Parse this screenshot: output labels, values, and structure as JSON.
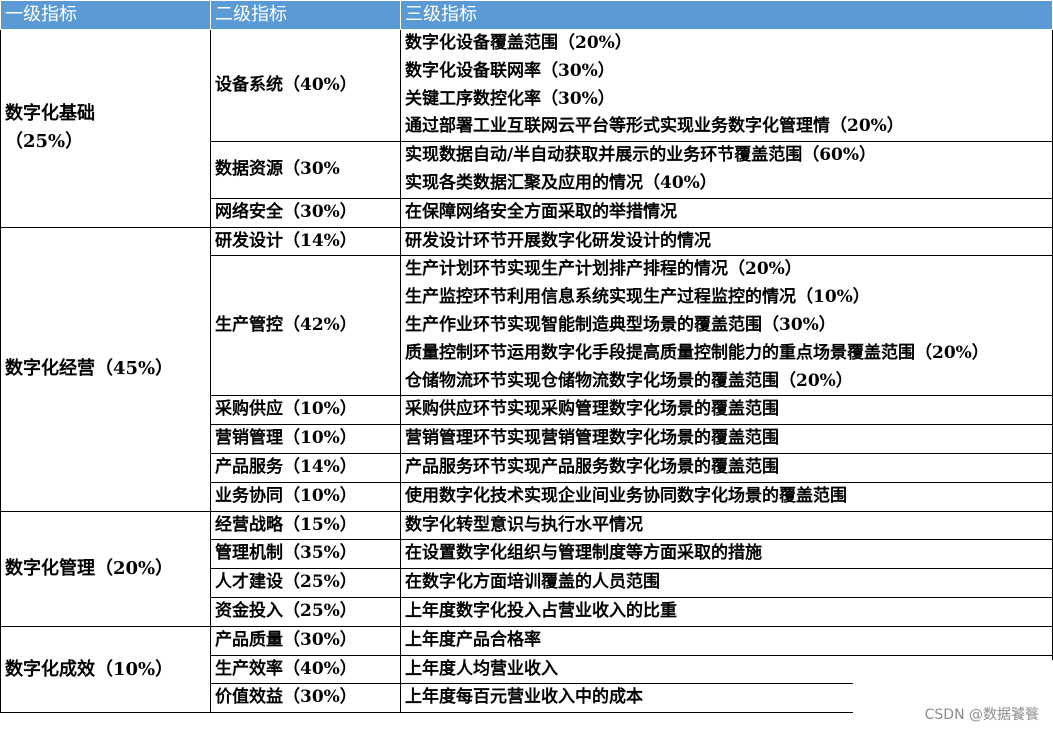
{
  "headers": [
    "一级指标",
    "二级指标",
    "三级指标"
  ],
  "groups": [
    {
      "l1": "数字化基础\n（25%）",
      "rows": [
        {
          "l2": "设备系统（40%）",
          "l3": [
            "数字化设备覆盖范围（20%）",
            "数字化设备联网率（30%）",
            "关键工序数控化率（30%）",
            "通过部署工业互联网云平台等形式实现业务数字化管理情（20%）"
          ]
        },
        {
          "l2": "数据资源（30%",
          "l3": [
            "实现数据自动/半自动获取并展示的业务环节覆盖范围（60%）",
            "实现各类数据汇聚及应用的情况（40%）"
          ]
        },
        {
          "l2": "网络安全（30%）",
          "l3": [
            "在保障网络安全方面采取的举措情况"
          ]
        }
      ]
    },
    {
      "l1": "数字化经营（45%）",
      "rows": [
        {
          "l2": "研发设计（14%）",
          "l3": [
            "研发设计环节开展数字化研发设计的情况"
          ]
        },
        {
          "l2": "生产管控（42%）",
          "l3": [
            "生产计划环节实现生产计划排产排程的情况（20%）",
            "生产监控环节利用信息系统实现生产过程监控的情况（10%）",
            "生产作业环节实现智能制造典型场景的覆盖范围（30%）",
            "质量控制环节运用数字化手段提高质量控制能力的重点场景覆盖范围（20%）",
            "仓储物流环节实现仓储物流数字化场景的覆盖范围（20%）"
          ]
        },
        {
          "l2": "采购供应（10%）",
          "l3": [
            "采购供应环节实现采购管理数字化场景的覆盖范围"
          ]
        },
        {
          "l2": "营销管理（10%）",
          "l3": [
            "营销管理环节实现营销管理数字化场景的覆盖范围"
          ]
        },
        {
          "l2": "产品服务（14%）",
          "l3": [
            "产品服务环节实现产品服务数字化场景的覆盖范围"
          ]
        },
        {
          "l2": "业务协同（10%）",
          "l3": [
            "使用数字化技术实现企业间业务协同数字化场景的覆盖范围"
          ]
        }
      ]
    },
    {
      "l1": "数字化管理（20%）",
      "rows": [
        {
          "l2": "经营战略（15%）",
          "l3": [
            "数字化转型意识与执行水平情况"
          ]
        },
        {
          "l2": "管理机制（35%）",
          "l3": [
            "在设置数字化组织与管理制度等方面采取的措施"
          ]
        },
        {
          "l2": "人才建设（25%）",
          "l3": [
            "在数字化方面培训覆盖的人员范围"
          ]
        },
        {
          "l2": "资金投入（25%）",
          "l3": [
            "上年度数字化投入占营业收入的比重"
          ]
        }
      ]
    },
    {
      "l1": "数字化成效（10%）",
      "rows": [
        {
          "l2": "产品质量（30%）",
          "l3": [
            "上年度产品合格率"
          ]
        },
        {
          "l2": "生产效率（40%）",
          "l3": [
            "上年度人均营业收入"
          ]
        },
        {
          "l2": "价值效益（30%）",
          "l3": [
            "上年度每百元营业收入中的成本"
          ]
        }
      ]
    }
  ],
  "watermark": "CSDN @数据饕餮"
}
